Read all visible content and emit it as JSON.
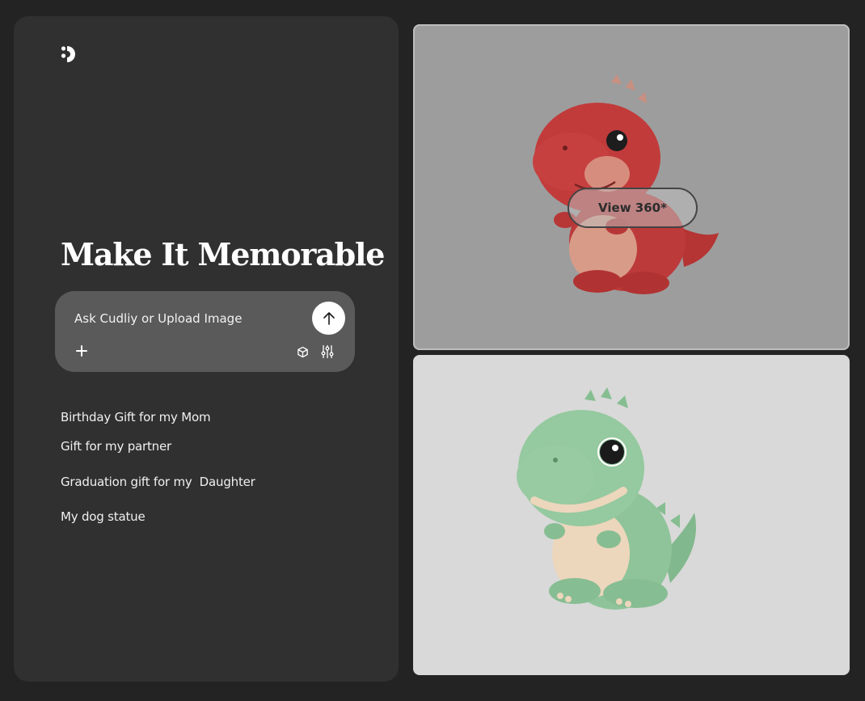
{
  "headline": "Make It Memorable",
  "prompt": {
    "placeholder": "Ask Cudliy or Upload Image"
  },
  "suggestions": [
    "Birthday Gift for my Mom",
    "Gift for my partner",
    "Graduation gift for my  Daughter",
    "My dog statue"
  ],
  "gallery": {
    "view_button_label": "View 360*"
  },
  "icons": {
    "logo": "cudliy-logo-icon",
    "send": "arrow-up-icon",
    "add": "plus-icon",
    "model": "cube-icon",
    "settings": "sliders-icon"
  },
  "colors": {
    "page_background": "#232323",
    "panel_background": "#303030",
    "prompt_background": "#5a5a5a",
    "red_card_background": "#9d9d9d",
    "green_card_background": "#d9d9d9",
    "red_dino": "#c23b3b",
    "green_dino": "#8fc49a"
  }
}
